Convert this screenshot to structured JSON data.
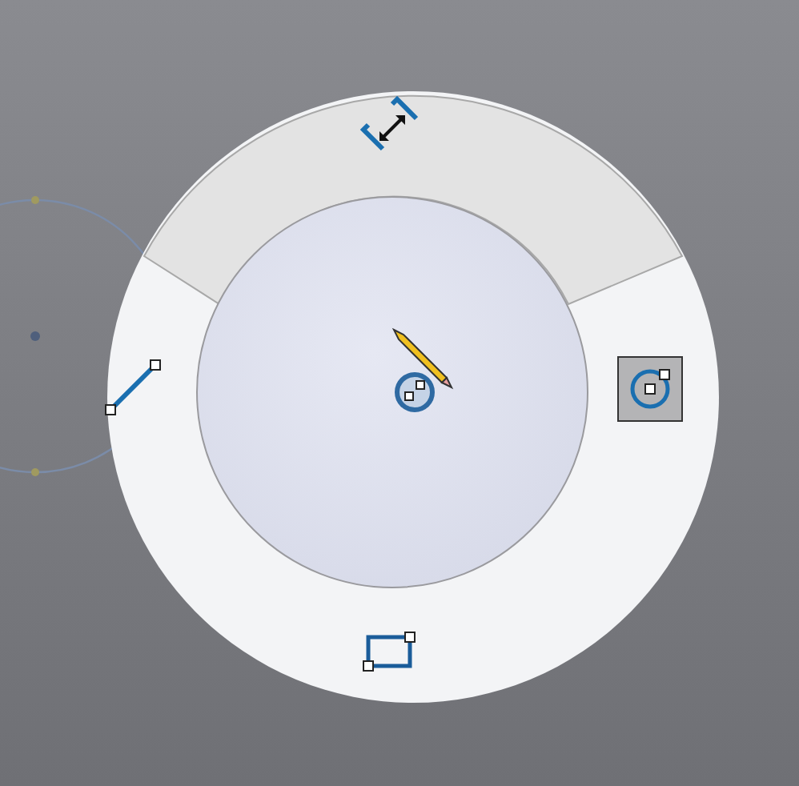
{
  "gesture_wheel": {
    "items": [
      {
        "kind": "smart-dimension",
        "hovered": true,
        "selected": false
      },
      {
        "kind": "circle",
        "hovered": false,
        "selected": true
      },
      {
        "kind": "rectangle",
        "hovered": false,
        "selected": false
      },
      {
        "kind": "line",
        "hovered": false,
        "selected": false
      }
    ]
  }
}
